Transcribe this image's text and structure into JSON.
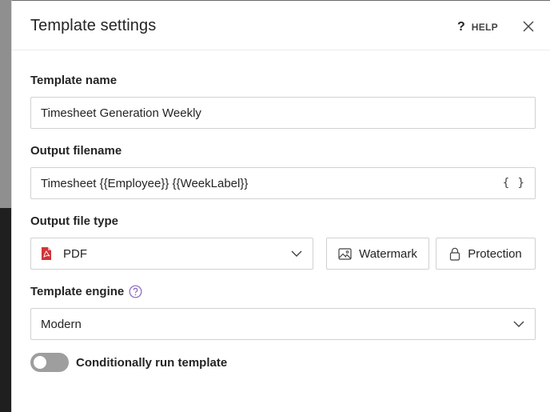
{
  "panel": {
    "title": "Template settings",
    "help_label": "HELP"
  },
  "template_name": {
    "label": "Template name",
    "value": "Timesheet Generation Weekly"
  },
  "output_filename": {
    "label": "Output filename",
    "value": "Timesheet {{Employee}} {{WeekLabel}}",
    "insert_variable_glyph": "{ }"
  },
  "output_file_type": {
    "label": "Output file type",
    "selected": "PDF",
    "watermark_label": "Watermark",
    "protection_label": "Protection"
  },
  "template_engine": {
    "label": "Template engine",
    "selected": "Modern"
  },
  "conditional": {
    "label": "Conditionally run template",
    "enabled": false
  },
  "colors": {
    "pdf_icon": "#d13438",
    "info_icon": "#8764b8",
    "toggle_off": "#9e9e9e",
    "border": "#d1d1d1"
  }
}
